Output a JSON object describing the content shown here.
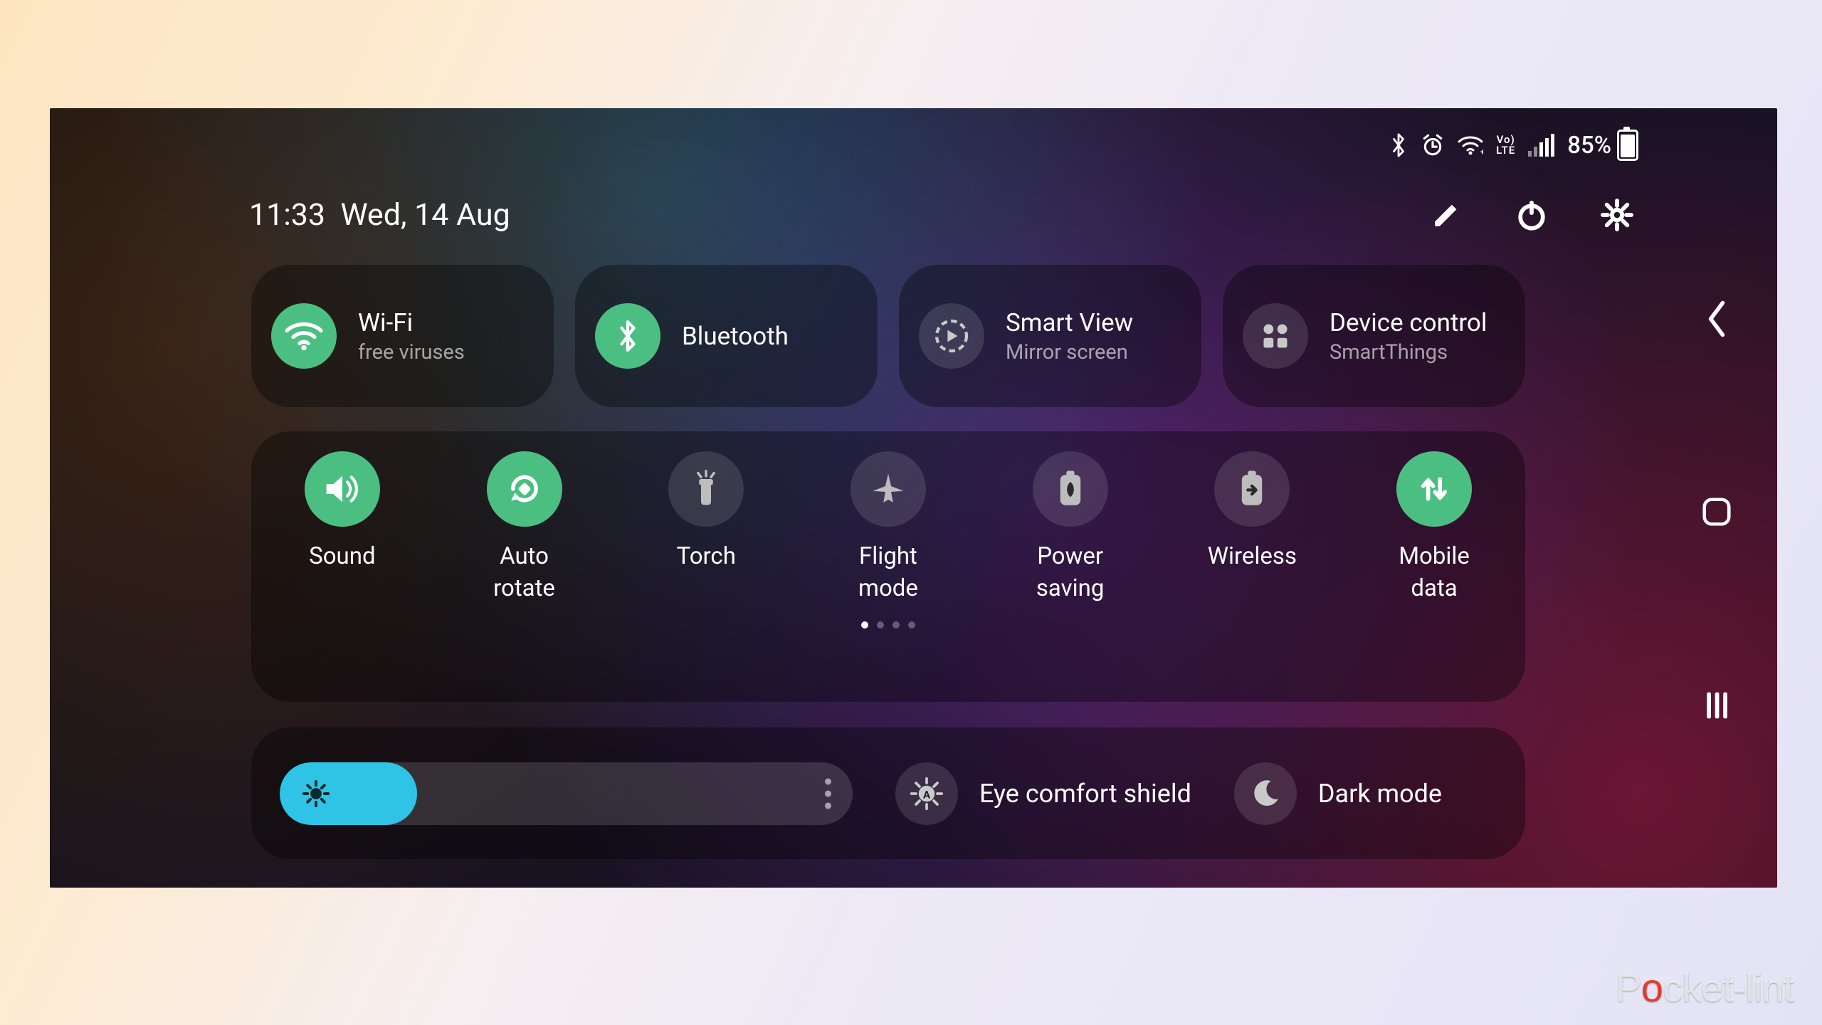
{
  "status_bar": {
    "battery_percent": "85%",
    "battery_fill_pct": 85,
    "volte_top": "Vo)",
    "volte_bottom": "LTE"
  },
  "header": {
    "time": "11:33",
    "date": "Wed, 14 Aug"
  },
  "tiles": [
    {
      "key": "wifi",
      "title": "Wi-Fi",
      "subtitle": "free viruses",
      "active": true
    },
    {
      "key": "bluetooth",
      "title": "Bluetooth",
      "subtitle": "",
      "active": true
    },
    {
      "key": "smart-view",
      "title": "Smart View",
      "subtitle": "Mirror screen",
      "active": false
    },
    {
      "key": "device-control",
      "title": "Device control",
      "subtitle": "SmartThings",
      "active": false
    }
  ],
  "toggles": [
    {
      "key": "sound",
      "label": "Sound",
      "active": true,
      "icon": "volume"
    },
    {
      "key": "auto-rotate",
      "label": "Auto rotate",
      "active": true,
      "icon": "rotate"
    },
    {
      "key": "torch",
      "label": "Torch",
      "active": false,
      "icon": "torch"
    },
    {
      "key": "flight-mode",
      "label": "Flight mode",
      "active": false,
      "icon": "airplane"
    },
    {
      "key": "power-saving",
      "label": "Power saving",
      "active": false,
      "icon": "leaf-batt"
    },
    {
      "key": "wireless",
      "label": "Wireless",
      "active": false,
      "icon": "share-batt"
    },
    {
      "key": "mobile-data",
      "label": "Mobile data",
      "active": true,
      "icon": "updown"
    }
  ],
  "pagination": {
    "pages": 4,
    "current": 0
  },
  "brightness": {
    "percent": 24
  },
  "bottom_toggles": [
    {
      "key": "eye-comfort",
      "label": "Eye comfort shield",
      "active": false,
      "icon": "sun-a"
    },
    {
      "key": "dark-mode",
      "label": "Dark mode",
      "active": false,
      "icon": "moon"
    }
  ],
  "watermark": {
    "pre": "P",
    "mid": "o",
    "post": "cket-lint"
  }
}
